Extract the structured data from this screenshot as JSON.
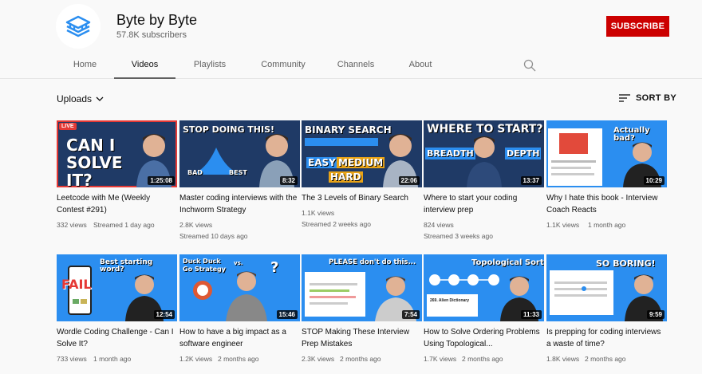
{
  "channel": {
    "name": "Byte by Byte",
    "subscribers": "57.8K subscribers",
    "subscribe_label": "SUBSCRIBE"
  },
  "tabs": [
    "Home",
    "Videos",
    "Playlists",
    "Community",
    "Channels",
    "About"
  ],
  "active_tab": "Videos",
  "filter": {
    "uploads_label": "Uploads",
    "sort_label": "SORT BY"
  },
  "colors": {
    "subscribe": "#cc0000",
    "thumb_blue": "#2b8ef0",
    "dark_thumb": "#1f3a66",
    "live_red": "#e53935"
  },
  "videos": [
    {
      "title": "Leetcode with Me (Weekly Contest #291)",
      "views": "332 views",
      "age": "Streamed 1 day ago",
      "duration": "1:25:08",
      "live_badge": "LIVE",
      "thumb_text": "CAN I SOLVE IT?"
    },
    {
      "title": "Master coding interviews with the Inchworm Strategy",
      "views": "2.8K views",
      "age": "Streamed 10 days ago",
      "duration": "8:32",
      "thumb_text": "STOP DOING THIS!",
      "thumb_sub1": "BAD",
      "thumb_sub2": "BEST"
    },
    {
      "title": "The 3 Levels of Binary Search",
      "views": "1.1K views",
      "age": "Streamed 2 weeks ago",
      "duration": "22:06",
      "thumb_text": "BINARY SEARCH",
      "thumb_sub1": "EASY",
      "thumb_sub2": "MEDIUM",
      "thumb_sub3": "HARD"
    },
    {
      "title": "Where to start your coding interview prep",
      "views": "824 views",
      "age": "Streamed 3 weeks ago",
      "duration": "13:37",
      "thumb_text": "WHERE TO START?",
      "thumb_sub1": "BREADTH",
      "thumb_sub2": "DEPTH"
    },
    {
      "title": "Why I hate this book - Interview Coach Reacts",
      "views": "1.1K views",
      "age": "1 month ago",
      "duration": "10:29",
      "thumb_text": "Actually bad?"
    },
    {
      "title": "Wordle Coding Challenge - Can I Solve It?",
      "views": "733 views",
      "age": "1 month ago",
      "duration": "12:54",
      "thumb_text": "Best starting word?",
      "thumb_sub1": "FAIL"
    },
    {
      "title": "How to have a big impact as a software engineer",
      "views": "1.2K views",
      "age": "2 months ago",
      "duration": "15:46",
      "thumb_text": "Duck Duck Go Strategy",
      "thumb_sub1": "vs."
    },
    {
      "title": "STOP Making These Interview Prep Mistakes",
      "views": "2.3K views",
      "age": "2 months ago",
      "duration": "7:54",
      "thumb_text": "PLEASE don't do this..."
    },
    {
      "title": "How to Solve Ordering Problems Using Topological...",
      "views": "1.7K views",
      "age": "2 months ago",
      "duration": "11:33",
      "thumb_text": "Topological Sort",
      "thumb_sub1": "269. Alien Dictionary"
    },
    {
      "title": "Is prepping for coding interviews a waste of time?",
      "views": "1.8K views",
      "age": "2 months ago",
      "duration": "9:59",
      "thumb_text": "SO BORING!"
    }
  ]
}
